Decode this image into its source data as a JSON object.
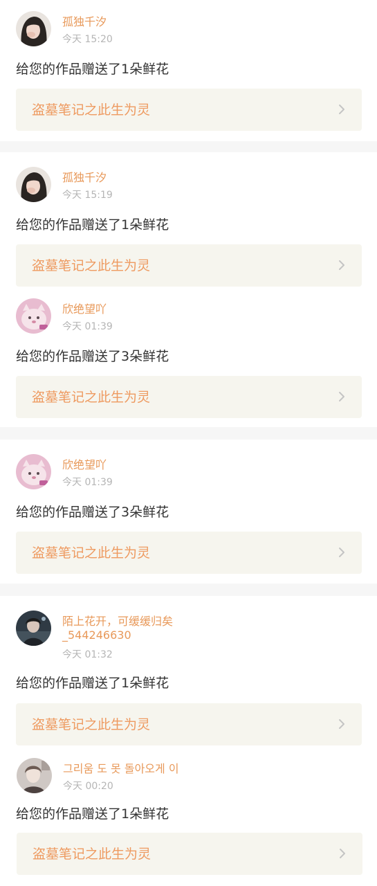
{
  "colors": {
    "accent": "#ee9a60",
    "name": "#e8995a",
    "time": "#b5b5b5",
    "message": "#333333",
    "card_bg": "#f6f5ee",
    "separator": "#f6f6f6"
  },
  "items": [
    {
      "user_name": "孤独千汐",
      "time": "今天 15:20",
      "message": "给您的作品赠送了1朵鲜花",
      "work_title": "盗墓笔记之此生为灵",
      "avatar_icon": "avatar-girl-dark-hair"
    },
    {
      "user_name": "孤独千汐",
      "time": "今天 15:19",
      "message": "给您的作品赠送了1朵鲜花",
      "work_title": "盗墓笔记之此生为灵",
      "avatar_icon": "avatar-girl-dark-hair"
    },
    {
      "user_name": "欣绝望吖",
      "time": "今天 01:39",
      "message": "给您的作品赠送了3朵鲜花",
      "work_title": "盗墓笔记之此生为灵",
      "avatar_icon": "avatar-pink-cat"
    },
    {
      "user_name": "欣绝望吖",
      "time": "今天 01:39",
      "message": "给您的作品赠送了3朵鲜花",
      "work_title": "盗墓笔记之此生为灵",
      "avatar_icon": "avatar-pink-cat"
    },
    {
      "user_name": "陌上花开，可缓缓归矣\n_544246630",
      "time": "今天 01:32",
      "message": "给您的作品赠送了1朵鲜花",
      "work_title": "盗墓笔记之此生为灵",
      "avatar_icon": "avatar-dark-figure"
    },
    {
      "user_name": "그리움 도 못 돌아오게 이",
      "time": "今天 00:20",
      "message": "给您的作品赠送了1朵鲜花",
      "work_title": "盗墓笔记之此生为灵",
      "avatar_icon": "avatar-light-portrait"
    }
  ]
}
